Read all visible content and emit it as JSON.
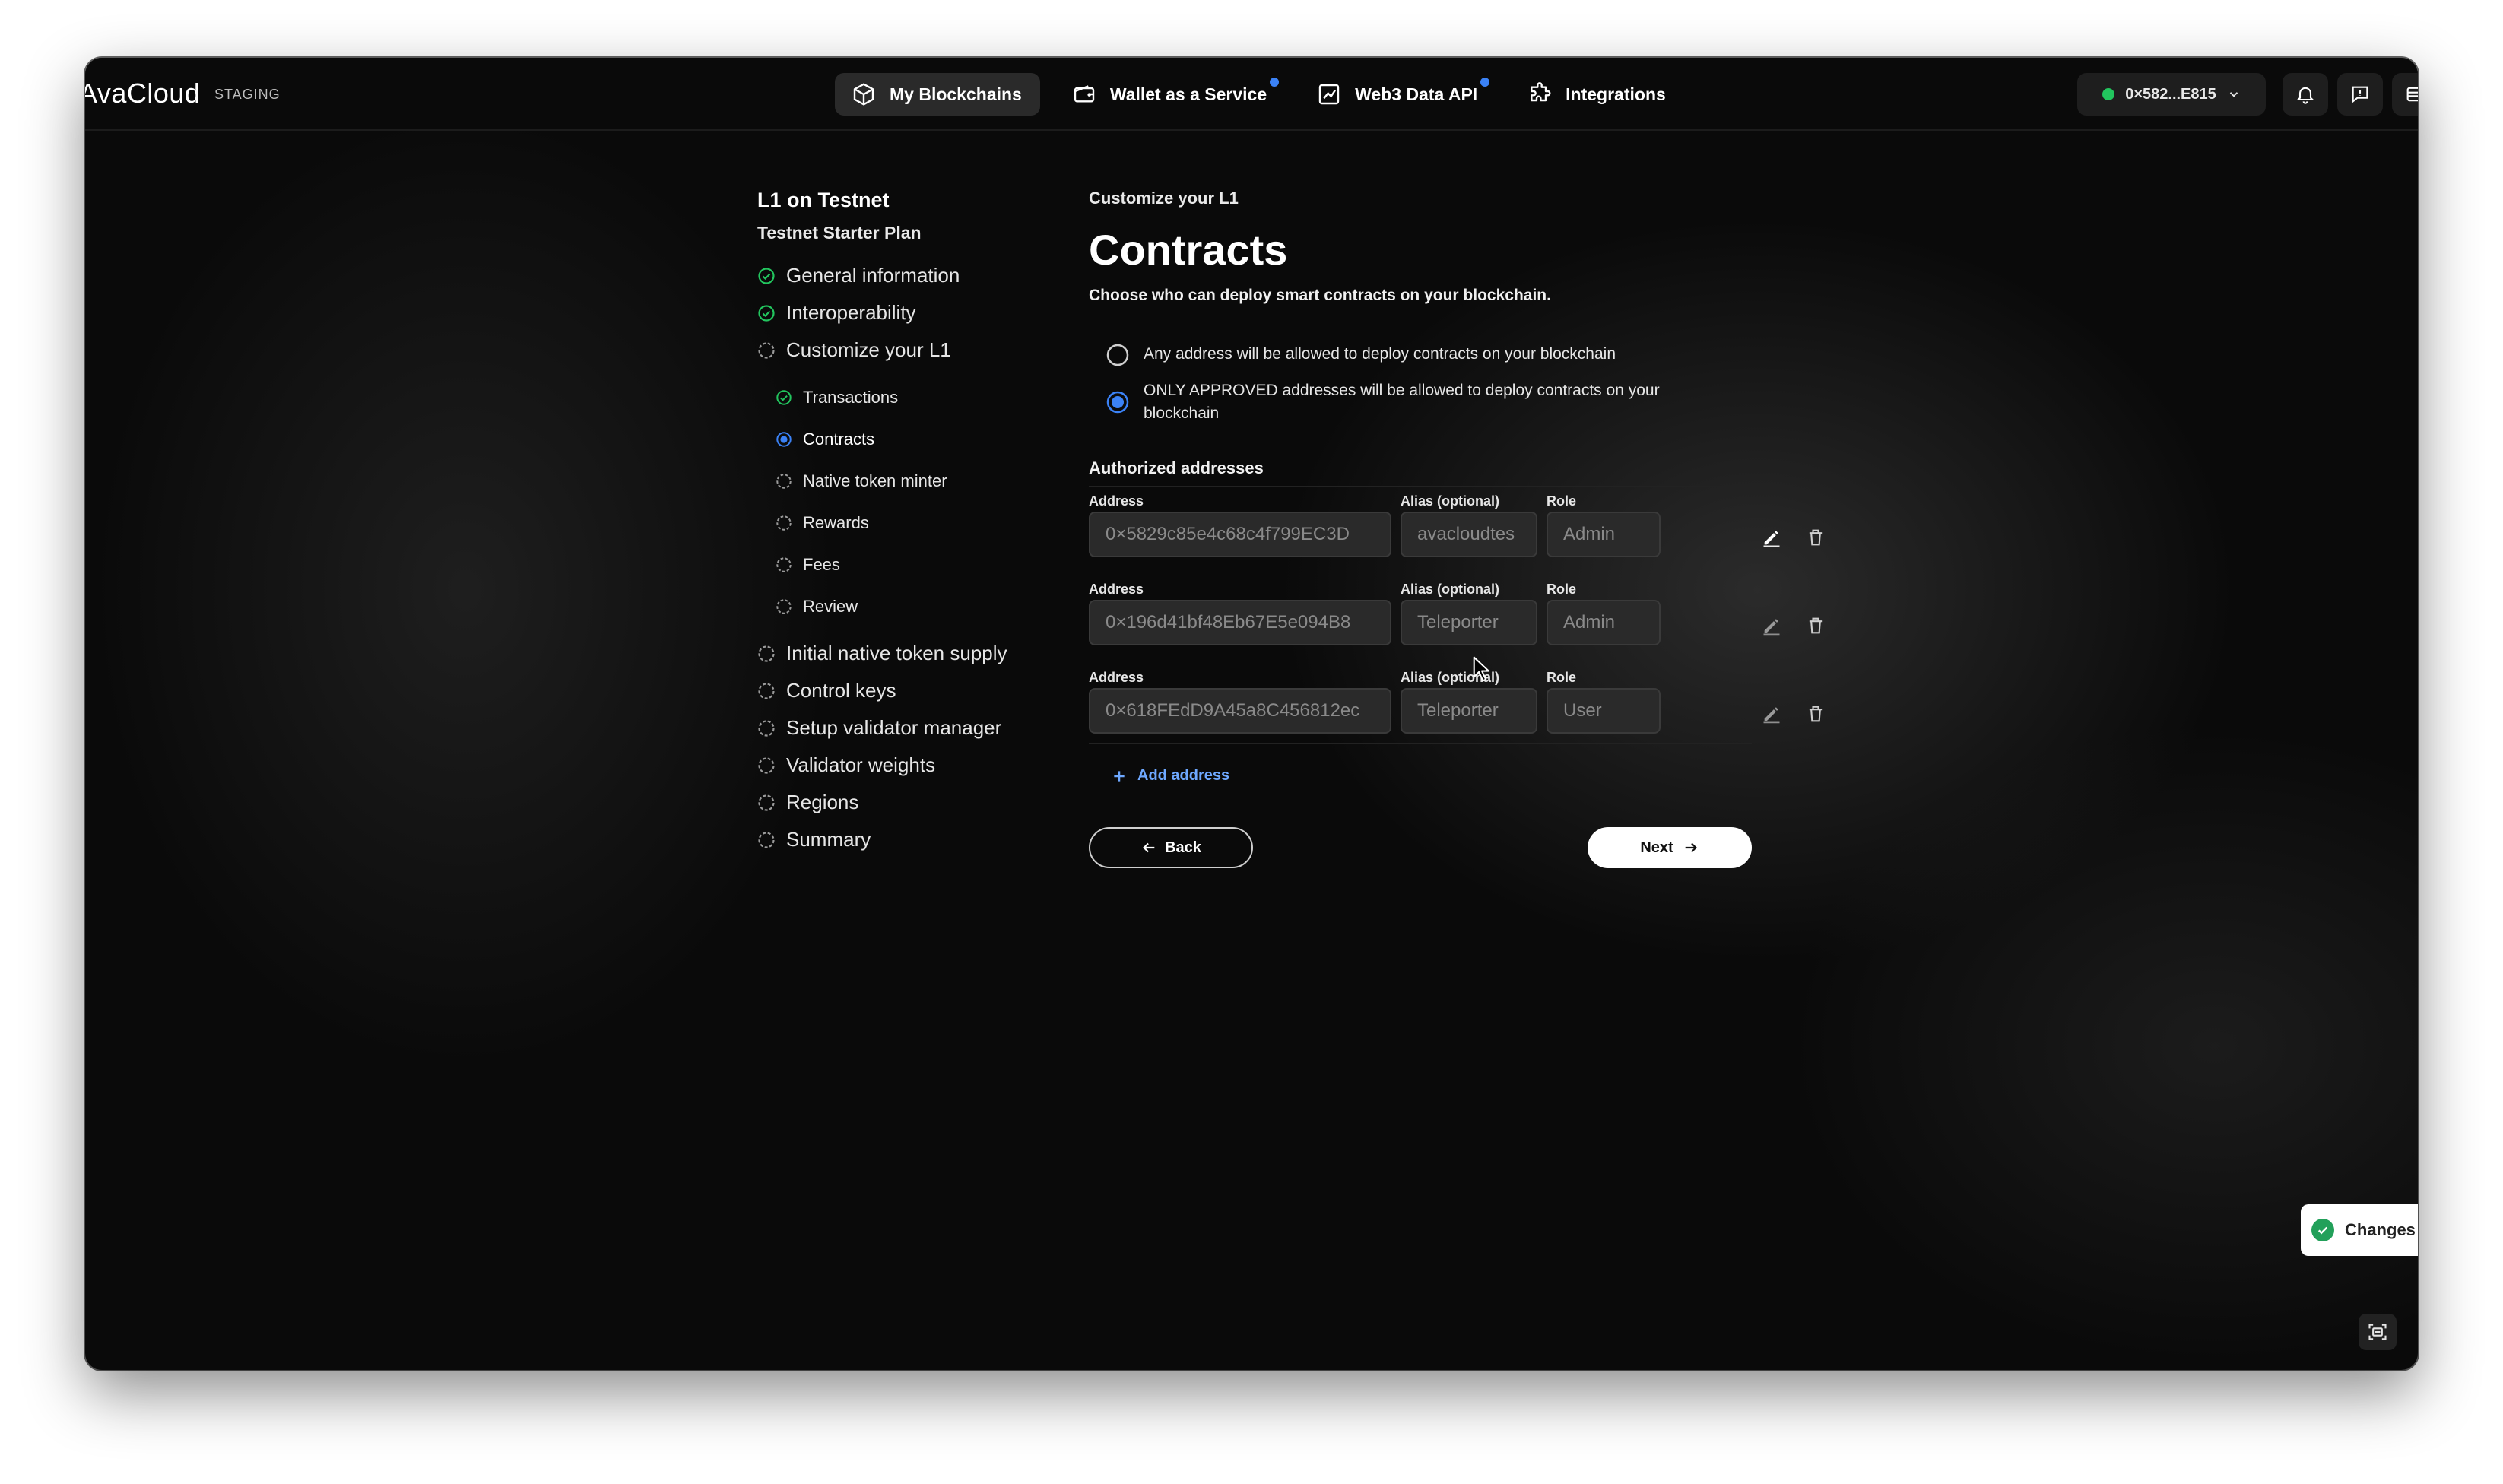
{
  "app": {
    "brand": "AvaCloud",
    "env_badge": "STAGING"
  },
  "nav": [
    {
      "label": "My Blockchains",
      "icon": "blockchain-cube-icon",
      "active": true
    },
    {
      "label": "Wallet as a Service",
      "icon": "wallet-icon",
      "badge": true
    },
    {
      "label": "Web3 Data API",
      "icon": "chart-icon",
      "badge": true
    },
    {
      "label": "Integrations",
      "icon": "puzzle-icon"
    }
  ],
  "wallet": {
    "address": "0×582...E815",
    "status_color": "#22c55e"
  },
  "sidebar": {
    "title": "L1 on Testnet",
    "plan": "Testnet Starter Plan",
    "steps": [
      {
        "label": "General information",
        "state": "done"
      },
      {
        "label": "Interoperability",
        "state": "done"
      },
      {
        "label": "Customize your L1",
        "state": "pending"
      }
    ],
    "substeps": [
      {
        "label": "Transactions",
        "state": "done"
      },
      {
        "label": "Contracts",
        "state": "current"
      },
      {
        "label": "Native token minter",
        "state": "pending"
      },
      {
        "label": "Rewards",
        "state": "pending"
      },
      {
        "label": "Fees",
        "state": "pending"
      },
      {
        "label": "Review",
        "state": "pending"
      }
    ],
    "steps_after": [
      {
        "label": "Initial native token supply",
        "state": "pending"
      },
      {
        "label": "Control keys",
        "state": "pending"
      },
      {
        "label": "Setup validator manager",
        "state": "pending"
      },
      {
        "label": "Validator weights",
        "state": "pending"
      },
      {
        "label": "Regions",
        "state": "pending"
      },
      {
        "label": "Summary",
        "state": "pending"
      }
    ]
  },
  "main": {
    "kicker": "Customize your L1",
    "title": "Contracts",
    "description": "Choose who can deploy smart contracts on your blockchain.",
    "options": [
      {
        "label": "Any address will be allowed to deploy contracts on your blockchain",
        "selected": false
      },
      {
        "label": "ONLY APPROVED addresses will be allowed to deploy contracts on your blockchain",
        "selected": true
      }
    ],
    "authorized_title": "Authorized addresses",
    "labels": {
      "address": "Address",
      "alias": "Alias (optional)",
      "role": "Role"
    },
    "addresses": [
      {
        "address": "0×5829c85e4c68c4f799EC3D",
        "alias": "avacloudtes",
        "role": "Admin"
      },
      {
        "address": "0×196d41bf48Eb67E5e094B8",
        "alias": "Teleporter",
        "role": "Admin"
      },
      {
        "address": "0×618FEdD9A45a8C456812ec",
        "alias": "Teleporter",
        "role": "User"
      }
    ],
    "add_address": "Add address",
    "back": "Back",
    "next": "Next"
  },
  "toast": {
    "text": "Changes"
  },
  "colors": {
    "accent": "#3b82f6",
    "success": "#22c55e",
    "link": "#6ea8ff"
  }
}
